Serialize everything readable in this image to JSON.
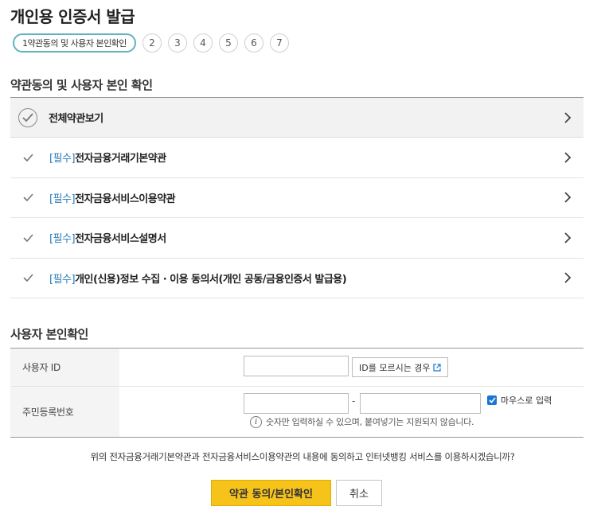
{
  "page": {
    "title": "개인용 인증서 발급"
  },
  "steps": {
    "active": "1약관동의 및 사용자 본인확인",
    "others": [
      "2",
      "3",
      "4",
      "5",
      "6",
      "7"
    ]
  },
  "terms": {
    "section_title": "약관동의 및 사용자 본인 확인",
    "all_label": "전체약관보기",
    "items": [
      {
        "tag": "[필수]",
        "label": "전자금융거래기본약관"
      },
      {
        "tag": "[필수]",
        "label": "전자금융서비스이용약관"
      },
      {
        "tag": "[필수]",
        "label": "전자금융서비스설명서"
      },
      {
        "tag": "[필수]",
        "label": "개인(신용)정보 수집 · 이용 동의서(개인 공동/금융인증서 발급용)"
      }
    ]
  },
  "verify": {
    "section_title": "사용자 본인확인",
    "user_id_label": "사용자 ID",
    "user_id_value": "",
    "forgot_id_button": "ID를 모르시는 경우",
    "rrn_label": "주민등록번호",
    "rrn_front_value": "",
    "rrn_back_value": "",
    "dash": "-",
    "mouse_input_label": "마우스로 입력",
    "mouse_input_checked": true,
    "hint": "숫자만 입력하실 수 있으며, 붙여넣기는 지원되지 않습니다."
  },
  "consent": {
    "question": "위의 전자금융거래기본약관과 전자금융서비스이용약관의 내용에 동의하고 인터넷뱅킹 서비스를 이용하시겠습니까?"
  },
  "buttons": {
    "agree": "약관 동의/본인확인",
    "cancel": "취소"
  },
  "colors": {
    "accent_teal": "#5fb5bf",
    "required_blue": "#2a7bb8",
    "primary_yellow": "#f6c31b",
    "checkbox_blue": "#1976d2"
  },
  "icons": {
    "all_terms": "circle-check-icon",
    "item_check": "check-icon",
    "row_arrow": "chevron-right-icon",
    "external": "external-link-icon",
    "info": "info-icon"
  }
}
